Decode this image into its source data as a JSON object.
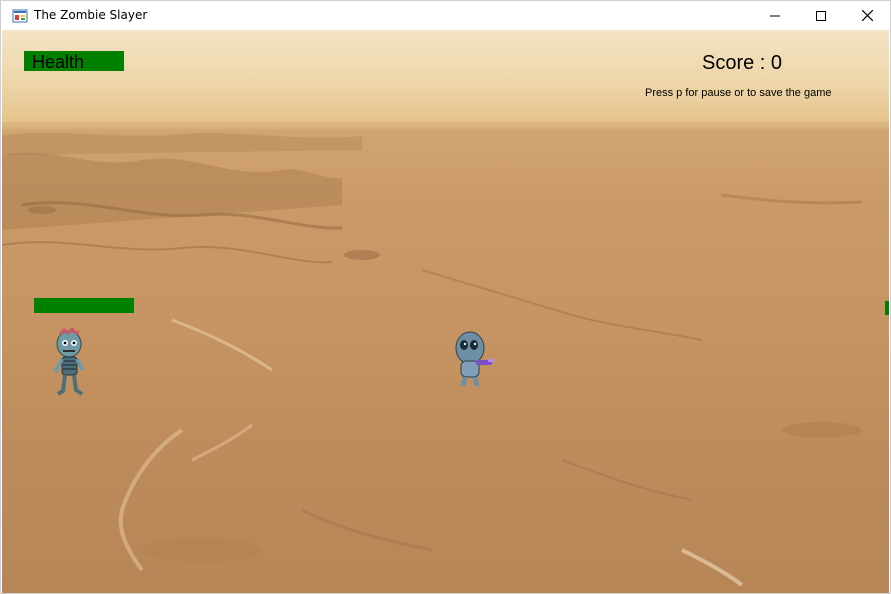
{
  "window": {
    "title": "The Zombie Slayer",
    "controls": [
      "minimize",
      "maximize",
      "close"
    ]
  },
  "hud": {
    "health_label": "Health",
    "score_text": "Score : 0",
    "hint_text": "Press p for pause or to save the game"
  },
  "colors": {
    "health_bar": "#008000",
    "sky": "#f3e4c5",
    "ground": "#c69462"
  },
  "sprites": {
    "zombie": "zombie-sprite",
    "player": "alien-player-sprite"
  }
}
